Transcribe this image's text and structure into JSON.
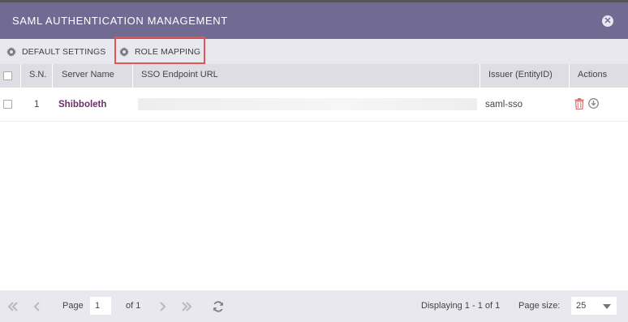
{
  "dialog": {
    "title": "SAML AUTHENTICATION MANAGEMENT",
    "close_icon": "close-icon"
  },
  "toolbar": {
    "default_settings": "DEFAULT SETTINGS",
    "role_mapping": "ROLE MAPPING",
    "icon": "gear-icon"
  },
  "table": {
    "columns": [
      "S.N.",
      "Server Name",
      "SSO Endpoint URL",
      "Issuer (EntityID)",
      "Actions"
    ],
    "rows": [
      {
        "sn": "1",
        "server_name": "Shibboleth",
        "sso_endpoint_url": "",
        "issuer": "saml-sso",
        "actions": [
          "trash-icon",
          "download-icon"
        ]
      }
    ]
  },
  "pagination": {
    "page_label": "Page",
    "page_value": "1",
    "of_label": "of 1",
    "displaying": "Displaying 1 - 1 of 1",
    "page_size_label": "Page size:",
    "page_size_value": "25"
  },
  "colors": {
    "titlebar": "#716a92",
    "server_name": "#6a2f68",
    "highlight": "#e05757",
    "delete_icon": "#e07070",
    "download_icon": "#8a8a8a"
  }
}
